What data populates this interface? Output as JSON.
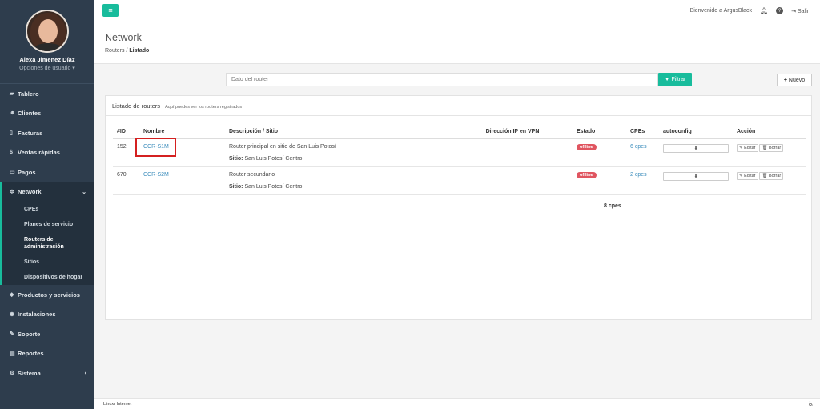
{
  "user": {
    "name": "Alexa Jimenez Díaz",
    "options": "Opciones de usuario ▾"
  },
  "menu": {
    "tablero": "Tablero",
    "clientes": "Clientes",
    "facturas": "Facturas",
    "ventas": "Ventas rápidas",
    "pagos": "Pagos",
    "network": "Network",
    "network_sub": [
      "CPEs",
      "Planes de servicio",
      "Routers de administración",
      "Sitios",
      "Dispositivos de hogar"
    ],
    "productos": "Productos y servicios",
    "instalaciones": "Instalaciones",
    "soporte": "Soporte",
    "reportes": "Reportes",
    "sistema": "Sistema"
  },
  "topbar": {
    "welcome": "Bienvenido a ArgusBlack",
    "logout": "Salir"
  },
  "header": {
    "title": "Network",
    "crumb_root": "Routers",
    "crumb_sep": "/",
    "crumb_current": "Listado"
  },
  "search": {
    "placeholder": "Dato del router",
    "filter_label": "Filtrar",
    "new_label": "Nuevo"
  },
  "panel": {
    "title": "Listado de routers",
    "hint": "Aquí puedes ver los routers registrados"
  },
  "table": {
    "headers": [
      "#ID",
      "Nombre",
      "Descripción / Sitio",
      "Dirección IP en VPN",
      "Estado",
      "CPEs",
      "autoconfig",
      "Acción"
    ],
    "site_label": "Sitio:",
    "rows": [
      {
        "id": "152",
        "name": "CCR-S1M",
        "description": "Router principal en sitio de San Luis Potosí",
        "site": "San Luis Potosí Centro",
        "ip": "",
        "status": "offline",
        "cpes": "6 cpes"
      },
      {
        "id": "670",
        "name": "CCR-S2M",
        "description": "Router secundario",
        "site": "San Luis Potosí Centro",
        "ip": "",
        "status": "offline",
        "cpes": "2 cpes"
      }
    ],
    "edit_label": "Editar",
    "delete_label": "Borrar",
    "total": "8 cpes"
  },
  "footer": {
    "text": "Linuxr Internet"
  },
  "colors": {
    "accent": "#18bc9c",
    "sidebar": "#2e3d4d",
    "offline": "#e05560",
    "highlight": "#d42020"
  }
}
